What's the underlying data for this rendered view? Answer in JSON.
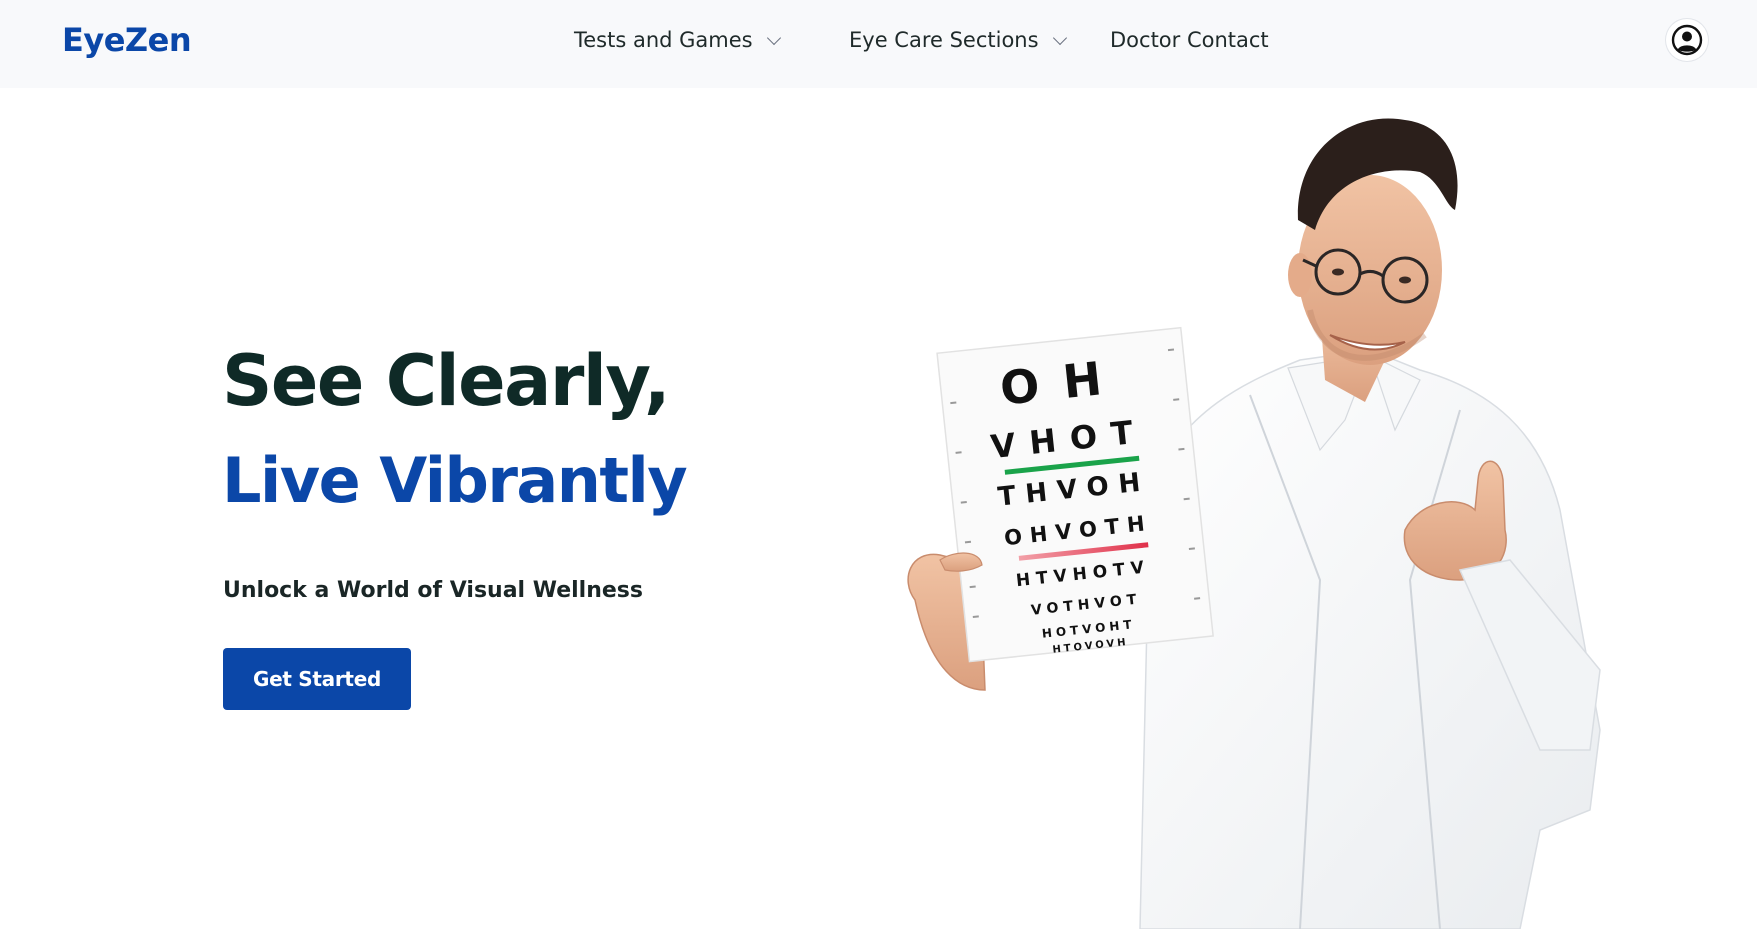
{
  "header": {
    "logo": "EyeZen",
    "nav": [
      {
        "label": "Tests and Games",
        "has_dropdown": true
      },
      {
        "label": "Eye Care Sections",
        "has_dropdown": true
      },
      {
        "label": "Doctor Contact",
        "has_dropdown": false
      }
    ],
    "profile_icon": "user-circle-icon"
  },
  "hero": {
    "title_line1": "See Clearly,",
    "title_line2": "Live Vibrantly",
    "subtitle": "Unlock a World of Visual Wellness",
    "cta_label": "Get Started",
    "image": "doctor-holding-eye-chart",
    "eye_chart_rows": [
      "OH",
      "VHOT",
      "THVOH",
      "OHVOTH",
      "HTVHOTV",
      "VOTHVOT",
      "HOTVOHT",
      "HTOVOVH"
    ]
  },
  "colors": {
    "brand_blue": "#0b47a8",
    "dark_text": "#0f2a27",
    "header_bg": "#f8f9fb",
    "chart_green_line": "#1aa34a",
    "chart_red_line": "#e0304a"
  }
}
